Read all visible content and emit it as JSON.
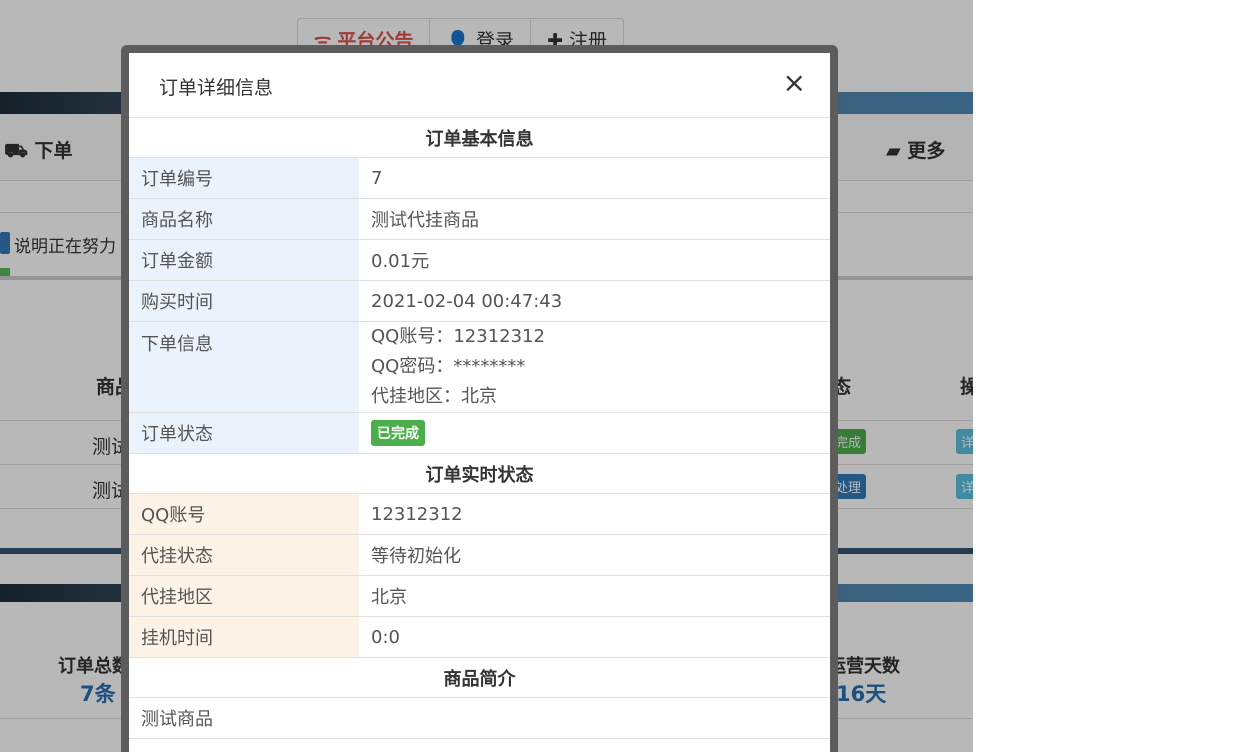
{
  "background": {
    "topnav": [
      {
        "icon": "wifi-icon",
        "glyph": "ᯤ",
        "label": "平台公告",
        "active": true
      },
      {
        "icon": "user-icon",
        "glyph": "👤",
        "label": "登录",
        "active": false
      },
      {
        "icon": "plus-icon",
        "glyph": "✚",
        "label": "注册",
        "active": false
      }
    ],
    "order_tab": "下单",
    "more_tab": "更多",
    "notice_text": "说明正在努力",
    "col_goods": "商品",
    "col_status": "态",
    "col_action": "操",
    "row1_goods": "测试",
    "row1_status": "完成",
    "row1_action": "详",
    "row2_goods": "测试",
    "row2_status": "处理",
    "row2_action": "详",
    "stat_orders_label": "订单总数",
    "stat_orders_value": "7条",
    "stat_days_label": "运营天数",
    "stat_days_value": "16天"
  },
  "modal": {
    "title": "订单详细信息",
    "close_glyph": "×",
    "basic_section": "订单基本信息",
    "basic": {
      "order_no_label": "订单编号",
      "order_no": "7",
      "product_label": "商品名称",
      "product": "测试代挂商品",
      "amount_label": "订单金额",
      "amount": "0.01元",
      "time_label": "购买时间",
      "time": "2021-02-04 00:47:43",
      "info_label": "下单信息",
      "info_lines": [
        "QQ账号：12312312",
        "QQ密码：********",
        "代挂地区：北京"
      ],
      "status_label": "订单状态",
      "status": "已完成"
    },
    "realtime_section": "订单实时状态",
    "realtime": {
      "qq_label": "QQ账号",
      "qq": "12312312",
      "agent_status_label": "代挂状态",
      "agent_status": "等待初始化",
      "region_label": "代挂地区",
      "region": "北京",
      "hang_time_label": "挂机时间",
      "hang_time": "0:0"
    },
    "intro_section": "商品简介",
    "intro_text": "测试商品"
  },
  "colors": {
    "accent_red": "#d9534f",
    "success_green": "#4cae4c",
    "link_blue": "#2a6fb0"
  }
}
